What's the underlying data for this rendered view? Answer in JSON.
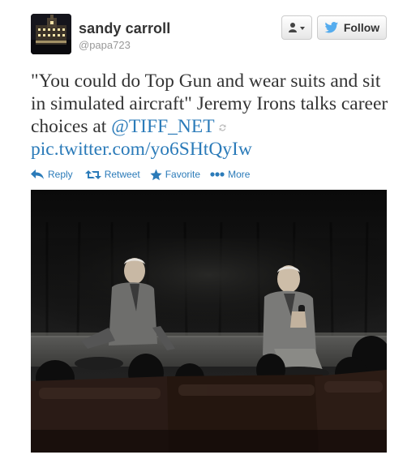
{
  "tweet": {
    "user_name": "sandy carroll",
    "handle": "@papa723",
    "follow_label": "Follow",
    "text_before_mention": "\"You could do Top Gun and wear suits and sit in simulated aircraft\" Jeremy Irons talks career choices at ",
    "mention": "@TIFF_NET",
    "pic_link": "pic.twitter.com/yo6SHtQyIw"
  },
  "actions": {
    "reply": "Reply",
    "retweet": "Retweet",
    "favorite": "Favorite",
    "more": "More"
  },
  "icons": {
    "user_dropdown": "user-dropdown-icon",
    "twitter_bird": "twitter-bird-icon",
    "expand": "conversation-expand-icon"
  },
  "colors": {
    "link": "#2b7bb9",
    "text": "#333333",
    "muted": "#999999"
  }
}
